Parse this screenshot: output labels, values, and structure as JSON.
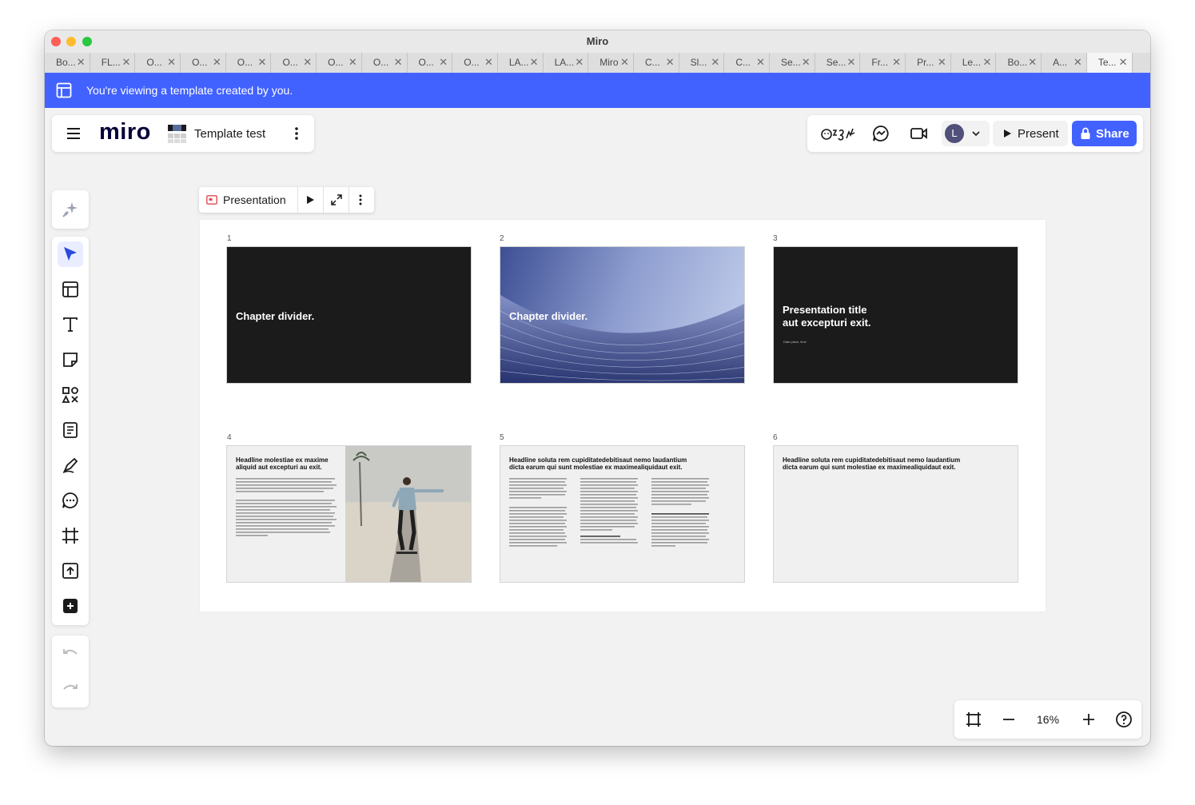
{
  "window": {
    "title": "Miro"
  },
  "tabs": [
    "Bo...",
    "FL...",
    "O...",
    "O...",
    "O...",
    "O...",
    "O...",
    "O...",
    "O...",
    "O...",
    "LA...",
    "LA...",
    "Miro",
    "C...",
    "Sl...",
    "C...",
    "Se...",
    "Se...",
    "Fr...",
    "Pr...",
    "Le...",
    "Bo...",
    "A...",
    "Te..."
  ],
  "banner": {
    "text": "You're viewing a template created by you."
  },
  "board": {
    "logo": "miro",
    "name": "Template test"
  },
  "topbar": {
    "avatar_initial": "L",
    "present_label": "Present",
    "share_label": "Share"
  },
  "frame_toolbar": {
    "label": "Presentation"
  },
  "slides": [
    {
      "number": "1",
      "title": "Chapter divider."
    },
    {
      "number": "2",
      "title": "Chapter divider."
    },
    {
      "number": "3",
      "title": "Presentation title\naut excepturi exit.",
      "subtitle": "Date place, time"
    },
    {
      "number": "4",
      "headline": "Headline molestiae ex maxime aliquid aut excepturi au exit."
    },
    {
      "number": "5",
      "headline": "Headline soluta rem cupiditatedebitisaut nemo laudantium dicta earum qui sunt molestiae ex maximealiquidaut exit."
    },
    {
      "number": "6",
      "headline": "Headline soluta rem cupiditatedebitisaut nemo laudantium dicta earum qui sunt molestiae ex maximealiquidaut exit."
    }
  ],
  "zoom": {
    "level": "16%"
  },
  "colors": {
    "accent": "#4262ff",
    "dark_slide": "#1b1b1c"
  }
}
